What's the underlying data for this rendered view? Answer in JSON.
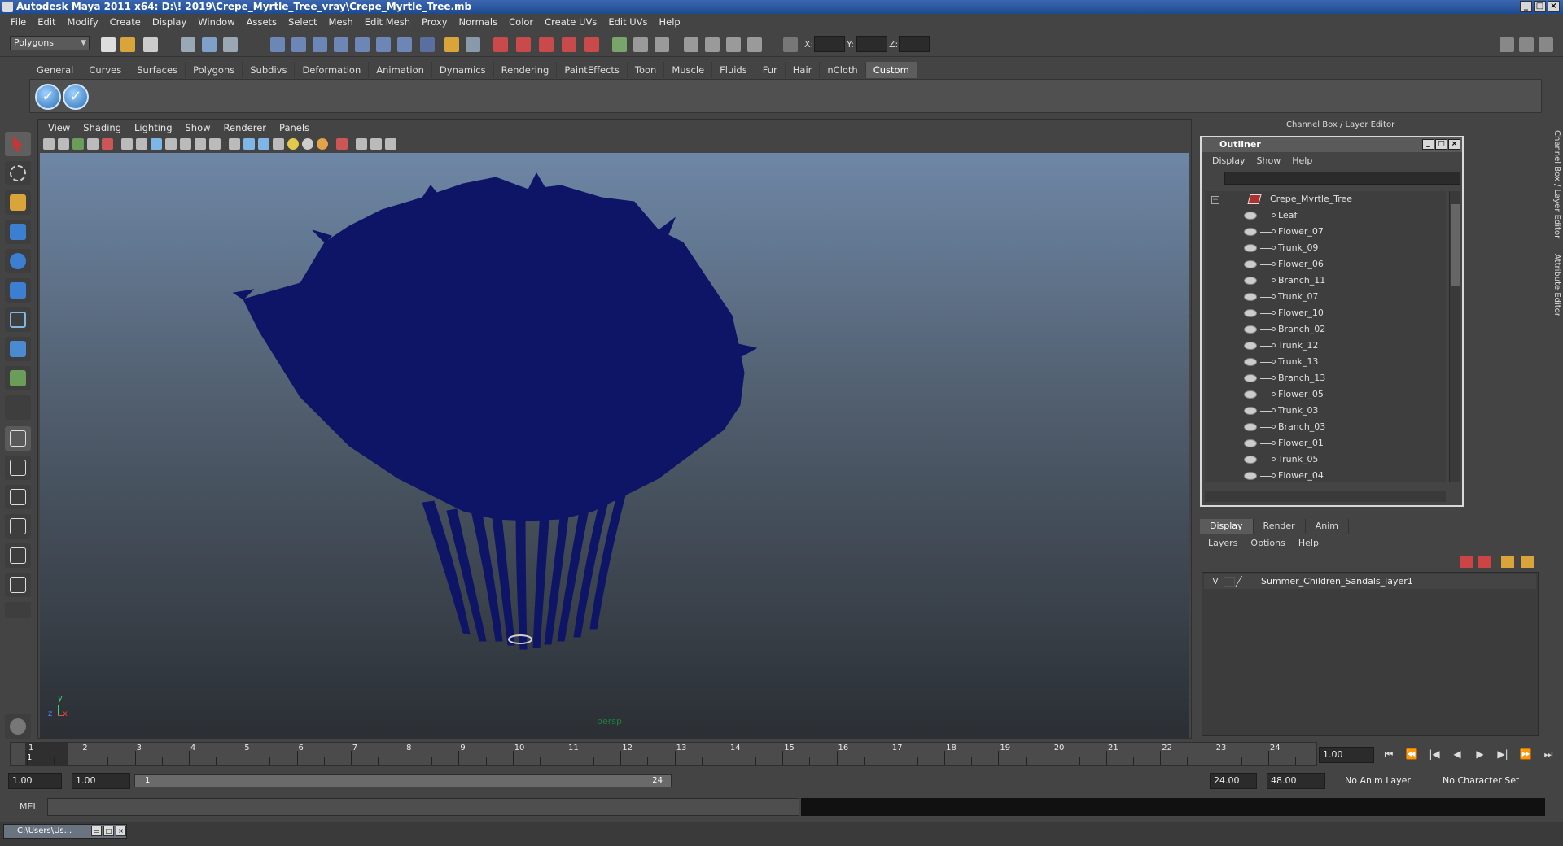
{
  "window": {
    "title": "Autodesk Maya 2011 x64: D:\\! 2019\\Crepe_Myrtle_Tree_vray\\Crepe_Myrtle_Tree.mb"
  },
  "menubar": [
    "File",
    "Edit",
    "Modify",
    "Create",
    "Display",
    "Window",
    "Assets",
    "Select",
    "Mesh",
    "Edit Mesh",
    "Proxy",
    "Normals",
    "Color",
    "Create UVs",
    "Edit UVs",
    "Help"
  ],
  "status": {
    "mode": "Polygons",
    "x_label": "X:",
    "y_label": "Y:",
    "z_label": "Z:"
  },
  "shelf": {
    "tabs": [
      "General",
      "Curves",
      "Surfaces",
      "Polygons",
      "Subdivs",
      "Deformation",
      "Animation",
      "Dynamics",
      "Rendering",
      "PaintEffects",
      "Toon",
      "Muscle",
      "Fluids",
      "Fur",
      "Hair",
      "nCloth",
      "Custom"
    ],
    "active": "Custom"
  },
  "viewport": {
    "menu": [
      "View",
      "Shading",
      "Lighting",
      "Show",
      "Renderer",
      "Panels"
    ],
    "camera": "persp",
    "axis_y": "y",
    "axis_x": "x",
    "axis_z": "z",
    "tree_color": "#0e1566"
  },
  "channel_box": {
    "title": "Channel Box / Layer Editor",
    "side_tab1": "Channel Box / Layer Editor",
    "side_tab2": "Attribute Editor"
  },
  "outliner": {
    "title": "Outliner",
    "menu": [
      "Display",
      "Show",
      "Help"
    ],
    "root": "Crepe_Myrtle_Tree",
    "items": [
      "Leaf",
      "Flower_07",
      "Trunk_09",
      "Flower_06",
      "Branch_11",
      "Trunk_07",
      "Flower_10",
      "Branch_02",
      "Trunk_12",
      "Trunk_13",
      "Branch_13",
      "Flower_05",
      "Trunk_03",
      "Branch_03",
      "Flower_01",
      "Trunk_05",
      "Flower_04"
    ]
  },
  "layers": {
    "tabs": [
      "Display",
      "Render",
      "Anim"
    ],
    "active_tab": "Display",
    "menu": [
      "Layers",
      "Options",
      "Help"
    ],
    "rows": [
      {
        "visible": "V",
        "name": "Summer_Children_Sandals_layer1"
      }
    ]
  },
  "timeline": {
    "ticks": [
      "1",
      "2",
      "3",
      "4",
      "5",
      "6",
      "7",
      "8",
      "9",
      "10",
      "11",
      "12",
      "13",
      "14",
      "15",
      "16",
      "17",
      "18",
      "19",
      "20",
      "21",
      "22",
      "23",
      "24"
    ],
    "current": "1",
    "current_field": "1.00"
  },
  "range": {
    "start": "1.00",
    "inner_start": "1.00",
    "slider_start": "1",
    "slider_end": "24",
    "end": "24.00",
    "outer_end": "48.00",
    "anim_layer": "No Anim Layer",
    "char_set": "No Character Set"
  },
  "cmdline": {
    "label": "MEL"
  },
  "taskbar": {
    "item": "C:\\Users\\Us..."
  }
}
